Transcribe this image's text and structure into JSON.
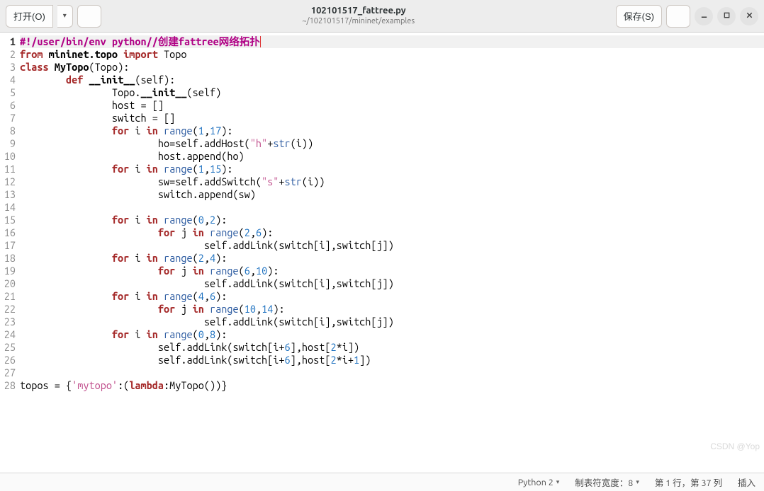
{
  "header": {
    "open_label": "打开(O)",
    "save_label": "保存(S)",
    "title": "102101517_fattree.py",
    "subtitle": "~/102101517/mininet/examples"
  },
  "status": {
    "language": "Python 2",
    "tab_width_label": "制表符宽度：8",
    "position": "第 1 行，第 37 列",
    "insert_mode": "插入"
  },
  "watermark": "CSDN @Yop",
  "code": {
    "lines": [
      {
        "n": 1,
        "cur": true,
        "tokens": [
          [
            "sh",
            "#!/user/bin/env python//创建fattree网络拓扑"
          ]
        ]
      },
      {
        "n": 2,
        "tokens": [
          [
            "kw",
            "from"
          ],
          [
            "id",
            " "
          ],
          [
            "mod",
            "mininet.topo"
          ],
          [
            "id",
            " "
          ],
          [
            "kw",
            "import"
          ],
          [
            "id",
            " Topo"
          ]
        ]
      },
      {
        "n": 3,
        "tokens": [
          [
            "kw",
            "class"
          ],
          [
            "id",
            " "
          ],
          [
            "cls",
            "MyTopo"
          ],
          [
            "id",
            "(Topo):"
          ]
        ]
      },
      {
        "n": 4,
        "tokens": [
          [
            "id",
            "        "
          ],
          [
            "kw",
            "def"
          ],
          [
            "id",
            " "
          ],
          [
            "def",
            "__init__"
          ],
          [
            "id",
            "(self):"
          ]
        ]
      },
      {
        "n": 5,
        "tokens": [
          [
            "id",
            "                Topo."
          ],
          [
            "def",
            "__init__"
          ],
          [
            "id",
            "(self)"
          ]
        ]
      },
      {
        "n": 6,
        "tokens": [
          [
            "id",
            "                host = []"
          ]
        ]
      },
      {
        "n": 7,
        "tokens": [
          [
            "id",
            "                switch = []"
          ]
        ]
      },
      {
        "n": 8,
        "tokens": [
          [
            "id",
            "                "
          ],
          [
            "kw",
            "for"
          ],
          [
            "id",
            " i "
          ],
          [
            "kw",
            "in"
          ],
          [
            "id",
            " "
          ],
          [
            "builtin",
            "range"
          ],
          [
            "id",
            "("
          ],
          [
            "num",
            "1"
          ],
          [
            "id",
            ","
          ],
          [
            "num",
            "17"
          ],
          [
            "id",
            "):"
          ]
        ]
      },
      {
        "n": 9,
        "tokens": [
          [
            "id",
            "                        ho=self.addHost("
          ],
          [
            "str",
            "\"h\""
          ],
          [
            "id",
            "+"
          ],
          [
            "builtin",
            "str"
          ],
          [
            "id",
            "(i))"
          ]
        ]
      },
      {
        "n": 10,
        "tokens": [
          [
            "id",
            "                        host.append(ho)"
          ]
        ]
      },
      {
        "n": 11,
        "tokens": [
          [
            "id",
            "                "
          ],
          [
            "kw",
            "for"
          ],
          [
            "id",
            " i "
          ],
          [
            "kw",
            "in"
          ],
          [
            "id",
            " "
          ],
          [
            "builtin",
            "range"
          ],
          [
            "id",
            "("
          ],
          [
            "num",
            "1"
          ],
          [
            "id",
            ","
          ],
          [
            "num",
            "15"
          ],
          [
            "id",
            "):"
          ]
        ]
      },
      {
        "n": 12,
        "tokens": [
          [
            "id",
            "                        sw=self.addSwitch("
          ],
          [
            "str",
            "\"s\""
          ],
          [
            "id",
            "+"
          ],
          [
            "builtin",
            "str"
          ],
          [
            "id",
            "(i))"
          ]
        ]
      },
      {
        "n": 13,
        "tokens": [
          [
            "id",
            "                        switch.append(sw)"
          ]
        ]
      },
      {
        "n": 14,
        "tokens": [
          [
            "id",
            ""
          ]
        ]
      },
      {
        "n": 15,
        "tokens": [
          [
            "id",
            "                "
          ],
          [
            "kw",
            "for"
          ],
          [
            "id",
            " i "
          ],
          [
            "kw",
            "in"
          ],
          [
            "id",
            " "
          ],
          [
            "builtin",
            "range"
          ],
          [
            "id",
            "("
          ],
          [
            "num",
            "0"
          ],
          [
            "id",
            ","
          ],
          [
            "num",
            "2"
          ],
          [
            "id",
            "):"
          ]
        ]
      },
      {
        "n": 16,
        "tokens": [
          [
            "id",
            "                        "
          ],
          [
            "kw",
            "for"
          ],
          [
            "id",
            " j "
          ],
          [
            "kw",
            "in"
          ],
          [
            "id",
            " "
          ],
          [
            "builtin",
            "range"
          ],
          [
            "id",
            "("
          ],
          [
            "num",
            "2"
          ],
          [
            "id",
            ","
          ],
          [
            "num",
            "6"
          ],
          [
            "id",
            "):"
          ]
        ]
      },
      {
        "n": 17,
        "tokens": [
          [
            "id",
            "                                self.addLink(switch[i],switch[j])"
          ]
        ]
      },
      {
        "n": 18,
        "tokens": [
          [
            "id",
            "                "
          ],
          [
            "kw",
            "for"
          ],
          [
            "id",
            " i "
          ],
          [
            "kw",
            "in"
          ],
          [
            "id",
            " "
          ],
          [
            "builtin",
            "range"
          ],
          [
            "id",
            "("
          ],
          [
            "num",
            "2"
          ],
          [
            "id",
            ","
          ],
          [
            "num",
            "4"
          ],
          [
            "id",
            "):"
          ]
        ]
      },
      {
        "n": 19,
        "tokens": [
          [
            "id",
            "                        "
          ],
          [
            "kw",
            "for"
          ],
          [
            "id",
            " j "
          ],
          [
            "kw",
            "in"
          ],
          [
            "id",
            " "
          ],
          [
            "builtin",
            "range"
          ],
          [
            "id",
            "("
          ],
          [
            "num",
            "6"
          ],
          [
            "id",
            ","
          ],
          [
            "num",
            "10"
          ],
          [
            "id",
            "):"
          ]
        ]
      },
      {
        "n": 20,
        "tokens": [
          [
            "id",
            "                                self.addLink(switch[i],switch[j])"
          ]
        ]
      },
      {
        "n": 21,
        "tokens": [
          [
            "id",
            "                "
          ],
          [
            "kw",
            "for"
          ],
          [
            "id",
            " i "
          ],
          [
            "kw",
            "in"
          ],
          [
            "id",
            " "
          ],
          [
            "builtin",
            "range"
          ],
          [
            "id",
            "("
          ],
          [
            "num",
            "4"
          ],
          [
            "id",
            ","
          ],
          [
            "num",
            "6"
          ],
          [
            "id",
            "):"
          ]
        ]
      },
      {
        "n": 22,
        "tokens": [
          [
            "id",
            "                        "
          ],
          [
            "kw",
            "for"
          ],
          [
            "id",
            " j "
          ],
          [
            "kw",
            "in"
          ],
          [
            "id",
            " "
          ],
          [
            "builtin",
            "range"
          ],
          [
            "id",
            "("
          ],
          [
            "num",
            "10"
          ],
          [
            "id",
            ","
          ],
          [
            "num",
            "14"
          ],
          [
            "id",
            "):"
          ]
        ]
      },
      {
        "n": 23,
        "tokens": [
          [
            "id",
            "                                self.addLink(switch[i],switch[j])"
          ]
        ]
      },
      {
        "n": 24,
        "tokens": [
          [
            "id",
            "                "
          ],
          [
            "kw",
            "for"
          ],
          [
            "id",
            " i "
          ],
          [
            "kw",
            "in"
          ],
          [
            "id",
            " "
          ],
          [
            "builtin",
            "range"
          ],
          [
            "id",
            "("
          ],
          [
            "num",
            "0"
          ],
          [
            "id",
            ","
          ],
          [
            "num",
            "8"
          ],
          [
            "id",
            "):"
          ]
        ]
      },
      {
        "n": 25,
        "tokens": [
          [
            "id",
            "                        self.addLink(switch[i+"
          ],
          [
            "num",
            "6"
          ],
          [
            "id",
            "],host["
          ],
          [
            "num",
            "2"
          ],
          [
            "id",
            "*i])"
          ]
        ]
      },
      {
        "n": 26,
        "tokens": [
          [
            "id",
            "                        self.addLink(switch[i+"
          ],
          [
            "num",
            "6"
          ],
          [
            "id",
            "],host["
          ],
          [
            "num",
            "2"
          ],
          [
            "id",
            "*i+"
          ],
          [
            "num",
            "1"
          ],
          [
            "id",
            "])"
          ]
        ]
      },
      {
        "n": 27,
        "tokens": [
          [
            "id",
            ""
          ]
        ]
      },
      {
        "n": 28,
        "tokens": [
          [
            "id",
            "topos = {"
          ],
          [
            "str",
            "'mytopo'"
          ],
          [
            "id",
            ":("
          ],
          [
            "kw",
            "lambda"
          ],
          [
            "id",
            ":MyTopo())}"
          ]
        ]
      }
    ]
  }
}
